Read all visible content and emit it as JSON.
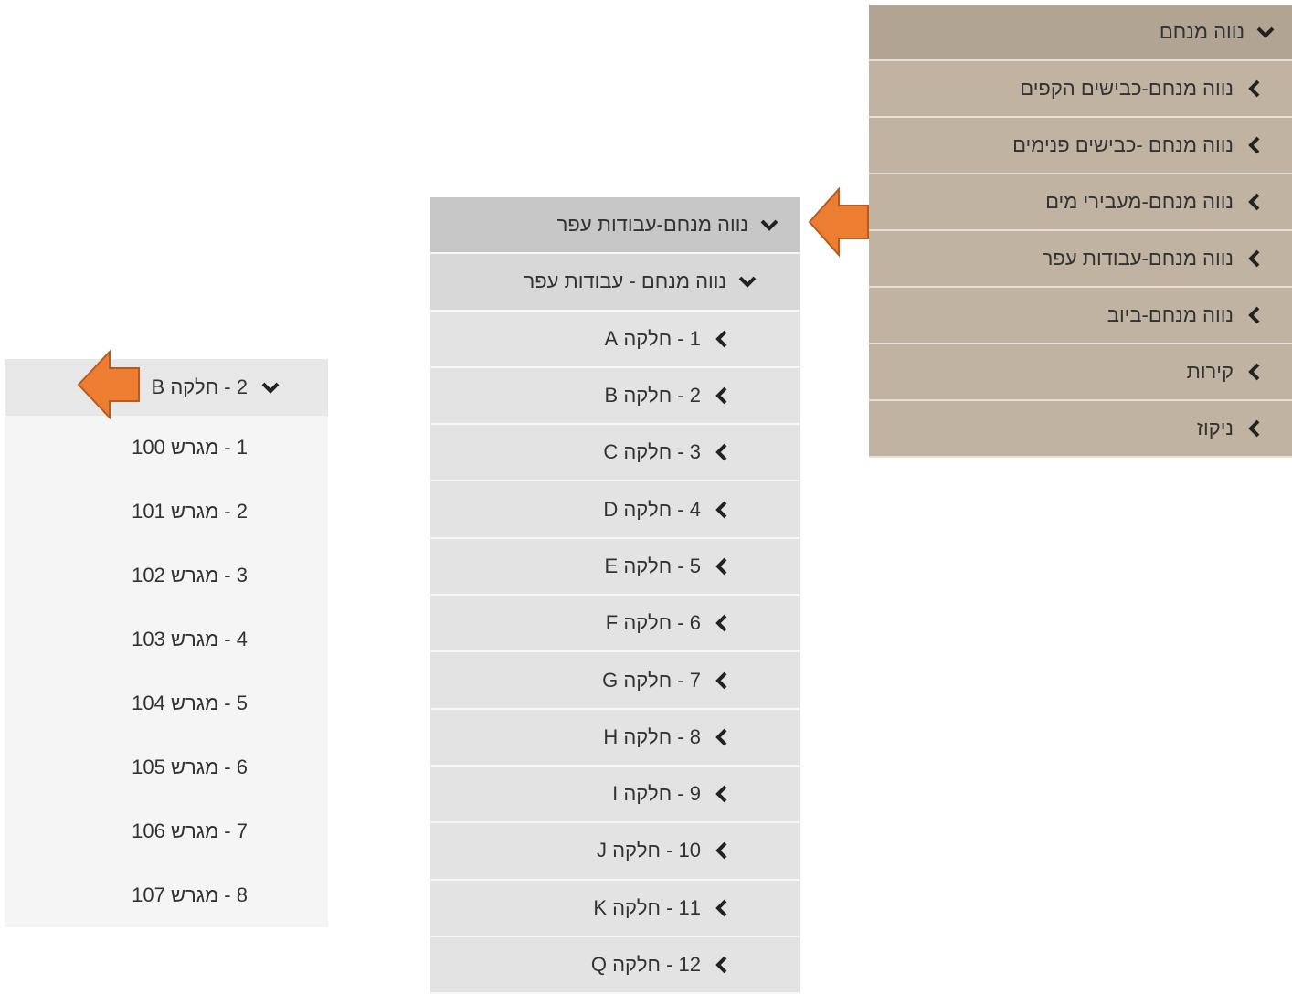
{
  "menus": {
    "right": {
      "header": "נווה מנחם",
      "items": [
        "נווה מנחם-כבישים הקפים",
        "נווה מנחם -כבישים פנימים",
        "נווה מנחם-מעבירי מים",
        "נווה מנחם-עבודות עפר",
        "נווה מנחם-ביוב",
        "קירות",
        "ניקוז"
      ]
    },
    "middle": {
      "header": "נווה מנחם-עבודות עפר",
      "subheader": "נווה מנחם - עבודות עפר",
      "items": [
        "1 - חלקה A",
        "2 - חלקה B",
        "3 - חלקה C",
        "4 - חלקה D",
        "5 - חלקה E",
        "6 - חלקה F",
        "7 - חלקה G",
        "8 - חלקה H",
        "9 - חלקה I",
        "10 - חלקה J",
        "11 - חלקה K",
        "12 - חלקה Q"
      ]
    },
    "left": {
      "header": "2 - חלקה B",
      "items": [
        "1 - מגרש 100",
        "2 - מגרש 101",
        "3 - מגרש 102",
        "4 - מגרש 103",
        "5 - מגרש 104",
        "6 - מגרש 105",
        "7 - מגרש 106",
        "8 - מגרש 107"
      ]
    }
  },
  "colors": {
    "right_menu_bg": "#c0b3a2",
    "right_menu_header_bg": "#b1a493",
    "middle_menu_bg": "#e3e3e3",
    "middle_menu_header_bg": "#c7c7c7",
    "left_menu_bg": "#f5f5f5",
    "callout_arrow": "#ed7d31"
  },
  "icons": {
    "expanded": "chevron-down-icon",
    "collapsed": "chevron-left-icon",
    "callout": "orange-arrow-left-icon"
  }
}
